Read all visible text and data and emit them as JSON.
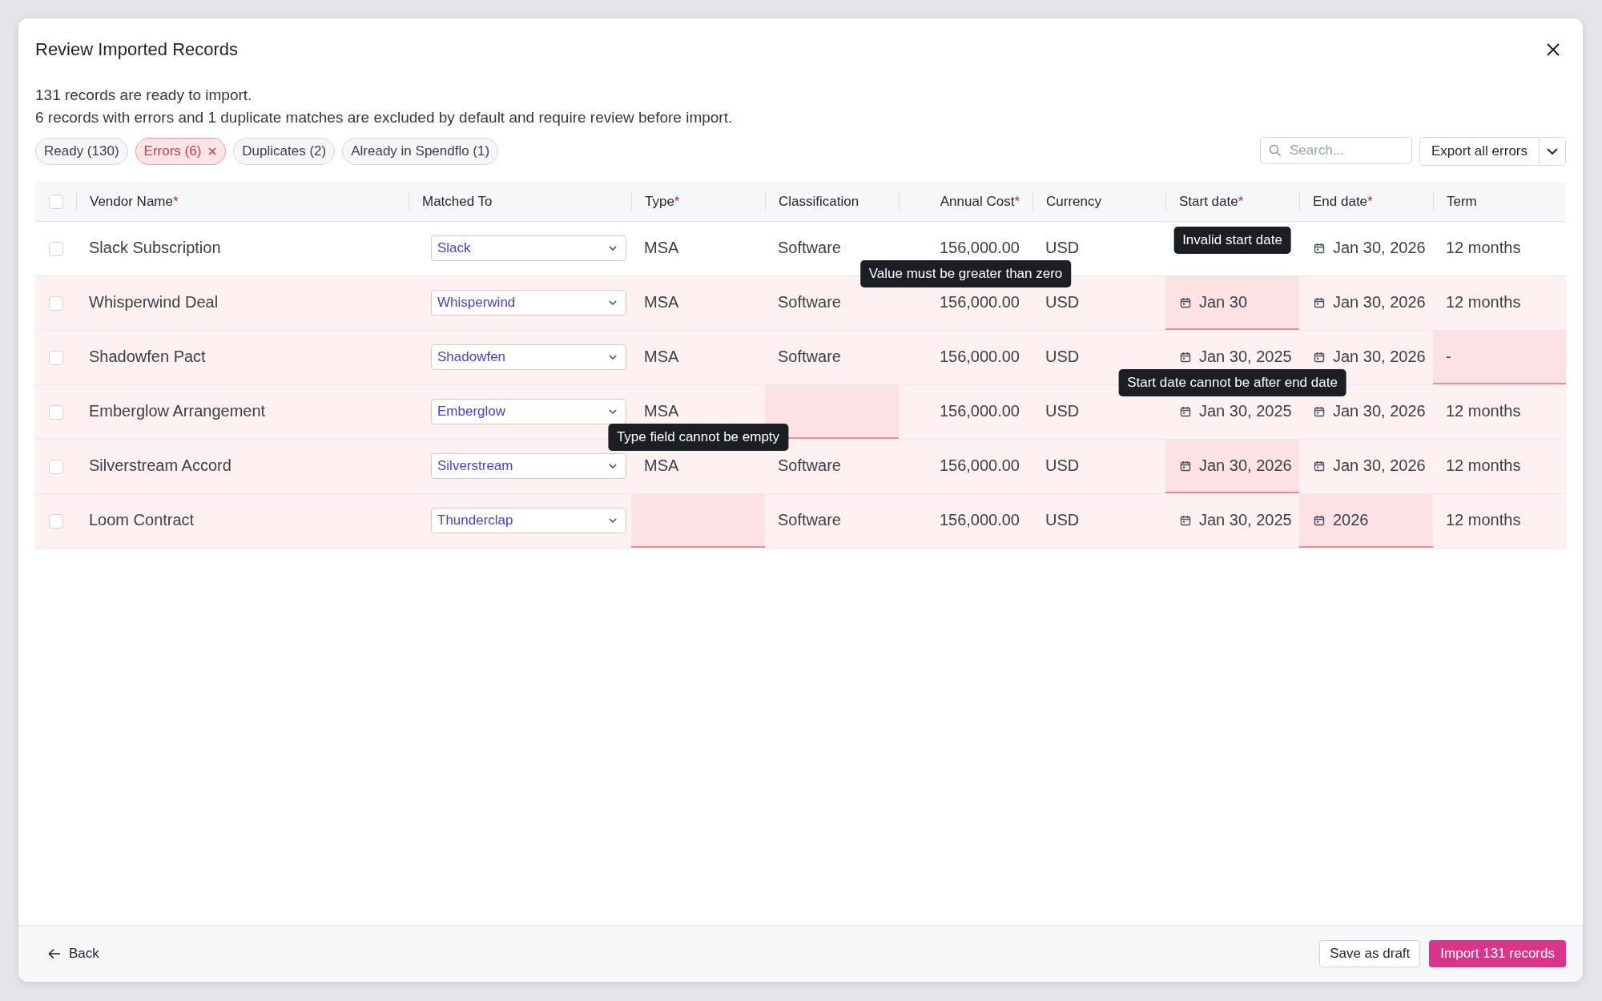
{
  "dialog": {
    "title": "Review Imported Records",
    "summary": "131 records are ready to import.",
    "note": "6 records with errors and 1 duplicate matches are excluded by default and require review before import."
  },
  "filters": [
    {
      "label": "Ready (130)",
      "selected": false
    },
    {
      "label": "Errors (6)",
      "selected": true
    },
    {
      "label": "Duplicates (2)",
      "selected": false
    },
    {
      "label": "Already in Spendflo (1)",
      "selected": false
    }
  ],
  "search": {
    "placeholder": "Search..."
  },
  "export_button": {
    "label": "Export all errors"
  },
  "table": {
    "select_all": {
      "checked": false
    },
    "columns": [
      {
        "kind": "name",
        "label": "Vendor Name",
        "marker": "*"
      },
      {
        "kind": "select",
        "label": "Matched To"
      },
      {
        "kind": "text",
        "label": "Type",
        "marker": "*"
      },
      {
        "kind": "text",
        "label": "Classification"
      },
      {
        "kind": "number",
        "label": "Annual Cost",
        "marker": "*"
      },
      {
        "kind": "text",
        "label": "Currency"
      },
      {
        "kind": "date",
        "label": "Start date",
        "marker": "*"
      },
      {
        "kind": "date",
        "label": "End date",
        "marker": "*"
      },
      {
        "kind": "text",
        "label": "Term"
      }
    ],
    "rows": [
      {
        "checked": false,
        "cells": [
          {
            "value": "Slack Subscription"
          },
          {
            "value": "Slack"
          },
          {
            "value": "MSA"
          },
          {
            "value": "Software"
          },
          {
            "value": "156,000.00",
            "tooltip": "Value must be greater than zero"
          },
          {
            "value": "USD"
          },
          {
            "tooltip": "Invalid start date"
          },
          {
            "value": "Jan 30, 2026"
          },
          {
            "value": "12 months"
          }
        ]
      },
      {
        "checked": false,
        "cells": [
          {
            "value": "Whisperwind Deal"
          },
          {
            "value": "Whisperwind"
          },
          {
            "value": "MSA"
          },
          {
            "value": "Software"
          },
          {
            "value": "156,000.00"
          },
          {
            "value": "USD"
          },
          {
            "value": "Jan 30",
            "error": true
          },
          {
            "value": "Jan 30, 2026"
          },
          {
            "value": "12 months"
          }
        ]
      },
      {
        "checked": false,
        "cells": [
          {
            "value": "Shadowfen Pact"
          },
          {
            "value": "Shadowfen"
          },
          {
            "value": "MSA"
          },
          {
            "value": "Software"
          },
          {
            "value": "156,000.00"
          },
          {
            "value": "USD"
          },
          {
            "value": "Jan 30, 2025",
            "tooltip": "Start date cannot be after end date"
          },
          {
            "value": "Jan 30, 2026"
          },
          {
            "value": "-",
            "error": true
          }
        ]
      },
      {
        "checked": false,
        "cells": [
          {
            "value": "Emberglow Arrangement"
          },
          {
            "value": "Emberglow"
          },
          {
            "value": "MSA",
            "tooltip": "Type field cannot be empty"
          },
          {
            "error": true
          },
          {
            "value": "156,000.00"
          },
          {
            "value": "USD"
          },
          {
            "value": "Jan 30, 2025"
          },
          {
            "value": "Jan 30, 2026"
          },
          {
            "value": "12 months"
          }
        ]
      },
      {
        "checked": false,
        "cells": [
          {
            "value": "Silverstream Accord"
          },
          {
            "value": "Silverstream"
          },
          {
            "value": "MSA"
          },
          {
            "value": "Software"
          },
          {
            "value": "156,000.00"
          },
          {
            "value": "USD"
          },
          {
            "value": "Jan 30, 2026",
            "error": true
          },
          {
            "value": "Jan 30, 2026"
          },
          {
            "value": "12 months"
          }
        ]
      },
      {
        "checked": false,
        "cells": [
          {
            "value": "Loom Contract"
          },
          {
            "value": "Thunderclap"
          },
          {
            "error": true
          },
          {
            "value": "Software"
          },
          {
            "value": "156,000.00"
          },
          {
            "value": "USD"
          },
          {
            "value": "Jan 30, 2025"
          },
          {
            "value": "2026",
            "error": true
          },
          {
            "value": "12 months"
          }
        ]
      }
    ]
  },
  "footer": {
    "back": "Back",
    "draft": "Save as draft",
    "import": "Import 131 records"
  }
}
